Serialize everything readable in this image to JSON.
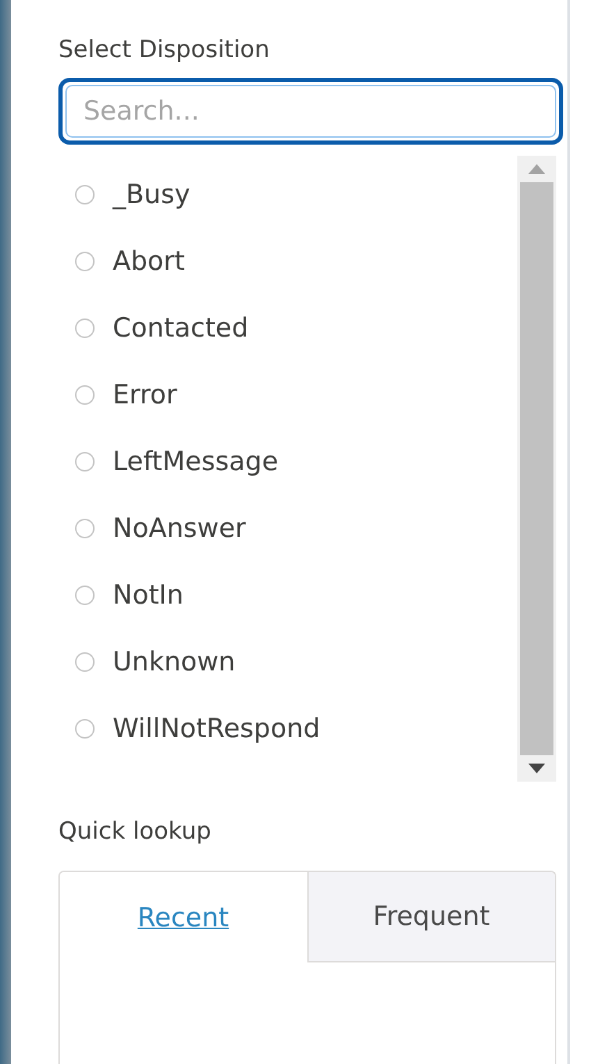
{
  "title": "Select Disposition",
  "search": {
    "placeholder": "Search..."
  },
  "options": [
    {
      "label": "_Busy",
      "selected": false
    },
    {
      "label": "Abort",
      "selected": false
    },
    {
      "label": "Contacted",
      "selected": false
    },
    {
      "label": "Error",
      "selected": false
    },
    {
      "label": "LeftMessage",
      "selected": false
    },
    {
      "label": "NoAnswer",
      "selected": false
    },
    {
      "label": "NotIn",
      "selected": false
    },
    {
      "label": "Unknown",
      "selected": false
    },
    {
      "label": "WillNotRespond",
      "selected": false
    }
  ],
  "quick_lookup": {
    "title": "Quick lookup",
    "tabs": [
      {
        "label": "Recent",
        "selected": true
      },
      {
        "label": "Frequent",
        "selected": false
      }
    ]
  }
}
